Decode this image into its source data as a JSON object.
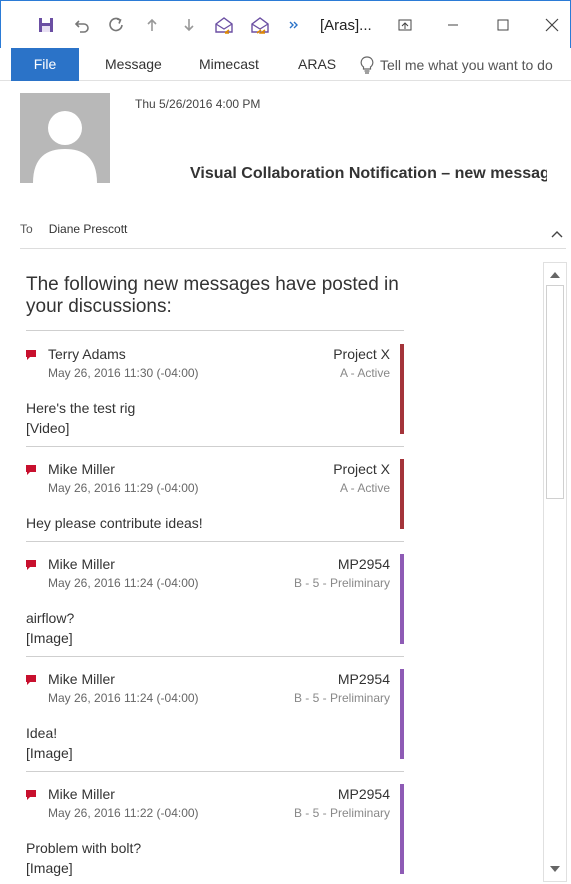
{
  "window": {
    "title": "[Aras]...",
    "quick_access": [
      "save-icon",
      "undo-icon",
      "redo-icon",
      "up-arrow-icon",
      "down-arrow-icon",
      "reply-envelope-icon",
      "reply-all-envelope-icon",
      "more-commands-icon"
    ],
    "controls": [
      "ribbon-display-icon",
      "minimize-icon",
      "maximize-icon",
      "close-icon"
    ]
  },
  "ribbon": {
    "tabs": [
      "File",
      "Message",
      "Mimecast",
      "ARAS"
    ],
    "tell_me": "Tell me what you want to do"
  },
  "header": {
    "date": "Thu 5/26/2016 4:00 PM",
    "subject": "Visual Collaboration Notification – new messages",
    "to_label": "To",
    "to_value": "Diane Prescott"
  },
  "body": {
    "intro": "The following new messages have posted in your discussions:",
    "messages": [
      {
        "author": "Terry Adams",
        "timestamp": "May 26, 2016 11:30 (-04:00)",
        "project": "Project X",
        "status": "A - Active",
        "line1": "Here's the test rig",
        "line2": "[Video]"
      },
      {
        "author": "Mike Miller",
        "timestamp": "May 26, 2016 11:29 (-04:00)",
        "project": "Project X",
        "status": "A - Active",
        "line1": "Hey please contribute ideas!",
        "line2": ""
      },
      {
        "author": "Mike Miller",
        "timestamp": "May 26, 2016 11:24 (-04:00)",
        "project": "MP2954",
        "status": "B - 5 - Preliminary",
        "line1": "airflow?",
        "line2": "[Image]"
      },
      {
        "author": "Mike Miller",
        "timestamp": "May 26, 2016 11:24 (-04:00)",
        "project": "MP2954",
        "status": "B - 5 - Preliminary",
        "line1": "Idea!",
        "line2": "[Image]"
      },
      {
        "author": "Mike Miller",
        "timestamp": "May 26, 2016 11:22 (-04:00)",
        "project": "MP2954",
        "status": "B - 5 - Preliminary",
        "line1": "Problem with bolt?",
        "line2": "[Image]"
      }
    ]
  },
  "colors": {
    "accent_blue": "#2b73c8",
    "flag_red": "#c8102e",
    "project_x_bar": "#a4343a",
    "mp2954_bar": "#8e5bb5"
  }
}
